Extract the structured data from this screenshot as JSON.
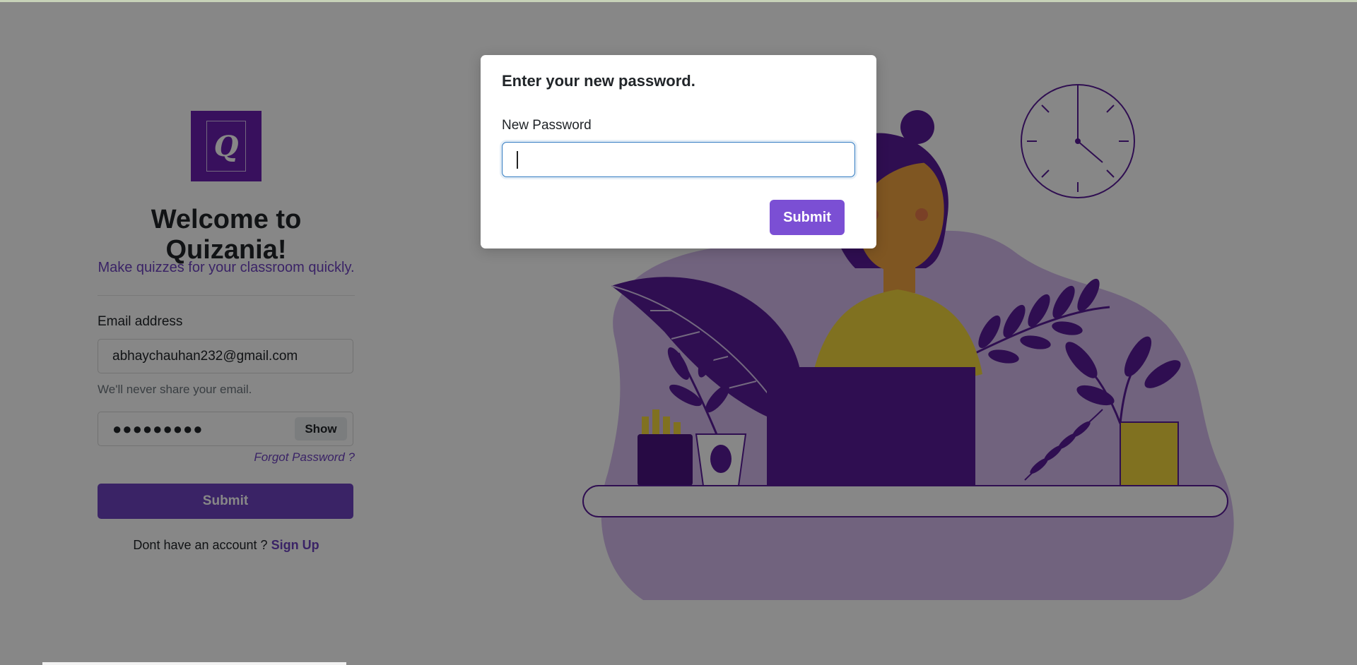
{
  "app": {
    "logo_letter": "Q",
    "title": "Welcome to Quizania!",
    "tagline": "Make quizzes for your classroom quickly."
  },
  "login_form": {
    "email_label": "Email address",
    "email_value": "abhaychauhan232@gmail.com",
    "email_help": "We'll never share your email.",
    "password_masked": "●●●●●●●●●",
    "show_label": "Show",
    "forgot_password_label": "Forgot Password ?",
    "submit_label": "Submit",
    "signup_prompt": "Dont have an account ?",
    "signup_link_label": "Sign Up"
  },
  "modal": {
    "title": "Enter your new password.",
    "field_label": "New Password",
    "field_value": "",
    "submit_label": "Submit"
  },
  "colors": {
    "brand_purple": "#6f42c1",
    "logo_purple": "#6a1fb0",
    "illustration_purple": "#5a1b9a",
    "illustration_yellow": "#f1d63e",
    "modal_button": "#7b4fd4",
    "focus_blue": "#2f79c0"
  },
  "illustration": {
    "description_icons": [
      "clock-icon",
      "woman-laptop-illustration",
      "plant-icon",
      "coffee-cup-icon",
      "pencil-cup-icon"
    ]
  }
}
